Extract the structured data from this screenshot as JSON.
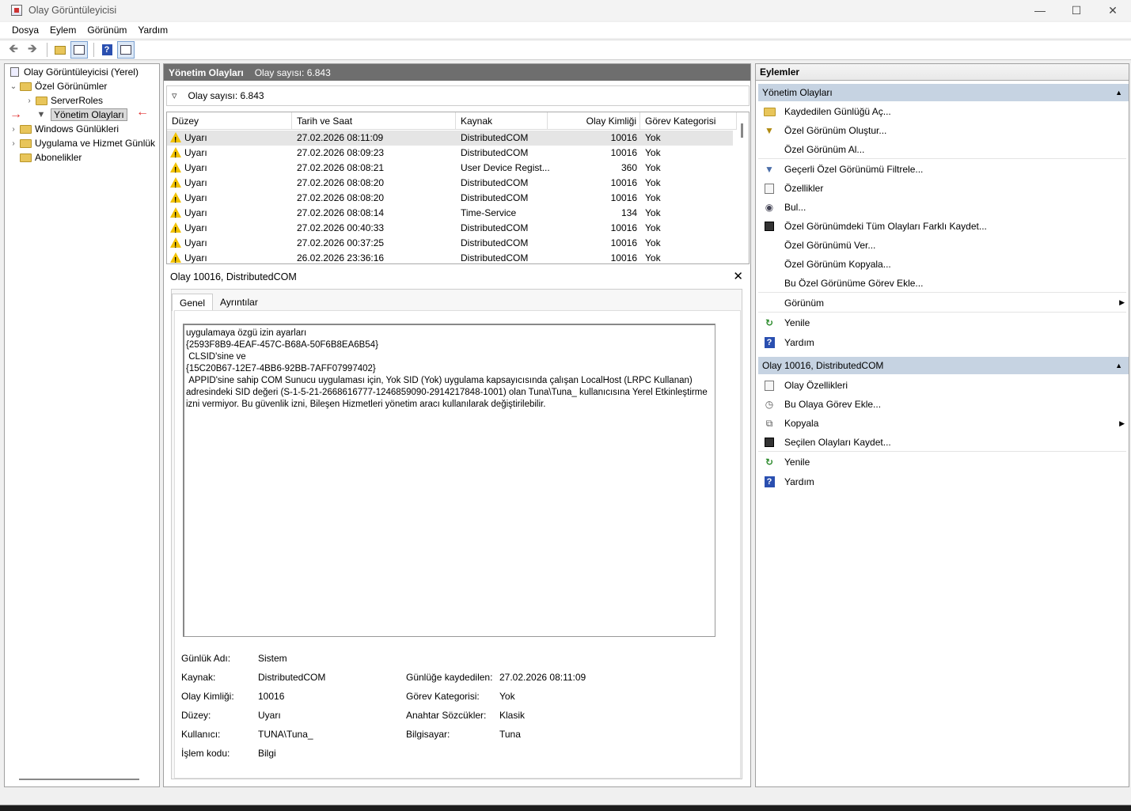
{
  "window": {
    "title": "Olay Görüntüleyicisi"
  },
  "menu": [
    "Dosya",
    "Eylem",
    "Görünüm",
    "Yardım"
  ],
  "tree": {
    "root": "Olay Görüntüleyicisi (Yerel)",
    "custom_views": "Özel Görünümler",
    "server_roles": "ServerRoles",
    "admin_events": "Yönetim Olayları",
    "windows_logs": "Windows Günlükleri",
    "app_service_logs": "Uygulama ve Hizmet Günlük",
    "subscriptions": "Abonelikler"
  },
  "middle": {
    "header_title": "Yönetim Olayları",
    "header_count": "Olay sayısı: 6.843",
    "filter_count": "Olay sayısı: 6.843",
    "columns": [
      "Düzey",
      "Tarih ve Saat",
      "Kaynak",
      "Olay Kimliği",
      "Görev Kategorisi"
    ],
    "rows": [
      {
        "level": "Uyarı",
        "date": "27.02.2026 08:11:09",
        "source": "DistributedCOM",
        "id": "10016",
        "category": "Yok"
      },
      {
        "level": "Uyarı",
        "date": "27.02.2026 08:09:23",
        "source": "DistributedCOM",
        "id": "10016",
        "category": "Yok"
      },
      {
        "level": "Uyarı",
        "date": "27.02.2026 08:08:21",
        "source": "User Device Regist...",
        "id": "360",
        "category": "Yok"
      },
      {
        "level": "Uyarı",
        "date": "27.02.2026 08:08:20",
        "source": "DistributedCOM",
        "id": "10016",
        "category": "Yok"
      },
      {
        "level": "Uyarı",
        "date": "27.02.2026 08:08:20",
        "source": "DistributedCOM",
        "id": "10016",
        "category": "Yok"
      },
      {
        "level": "Uyarı",
        "date": "27.02.2026 08:08:14",
        "source": "Time-Service",
        "id": "134",
        "category": "Yok"
      },
      {
        "level": "Uyarı",
        "date": "27.02.2026 00:40:33",
        "source": "DistributedCOM",
        "id": "10016",
        "category": "Yok"
      },
      {
        "level": "Uyarı",
        "date": "27.02.2026 00:37:25",
        "source": "DistributedCOM",
        "id": "10016",
        "category": "Yok"
      },
      {
        "level": "Uyarı",
        "date": "26.02.2026 23:36:16",
        "source": "DistributedCOM",
        "id": "10016",
        "category": "Yok"
      }
    ],
    "detail_title": "Olay 10016, DistributedCOM",
    "tabs": [
      "Genel",
      "Ayrıntılar"
    ],
    "message": "uygulamaya özgü izin ayarları\n{2593F8B9-4EAF-457C-B68A-50F6B8EA6B54}\n CLSID'sine ve\n{15C20B67-12E7-4BB6-92BB-7AFF07997402}\n APPID'sine sahip COM Sunucu uygulaması için, Yok SID (Yok) uygulama kapsayıcısında çalışan LocalHost (LRPC Kullanan)\nadresindeki SID değeri (S-1-5-21-2668616777-1246859090-2914217848-1001) olan Tuna\\Tuna_ kullanıcısına Yerel Etkinleştirme\nizni vermiyor. Bu güvenlik izni, Bileşen Hizmetleri yönetim aracı kullanılarak değiştirilebilir.",
    "props": {
      "log_name_label": "Günlük Adı:",
      "log_name": "Sistem",
      "source_label": "Kaynak:",
      "source": "DistributedCOM",
      "logged_label": "Günlüğe kaydedilen:",
      "logged": "27.02.2026 08:11:09",
      "event_id_label": "Olay Kimliği:",
      "event_id": "10016",
      "task_label": "Görev Kategorisi:",
      "task": "Yok",
      "level_label": "Düzey:",
      "level": "Uyarı",
      "keywords_label": "Anahtar Sözcükler:",
      "keywords": "Klasik",
      "user_label": "Kullanıcı:",
      "user": "TUNA\\Tuna_",
      "computer_label": "Bilgisayar:",
      "computer": "Tuna",
      "opcode_label": "İşlem kodu:",
      "opcode": "Bilgi"
    }
  },
  "actions": {
    "title": "Eylemler",
    "section1": "Yönetim Olayları",
    "items1": [
      "Kaydedilen Günlüğü Aç...",
      "Özel Görünüm Oluştur...",
      "Özel Görünüm Al...",
      "Geçerli Özel Görünümü Filtrele...",
      "Özellikler",
      "Bul...",
      "Özel Görünümdeki Tüm Olayları Farklı Kaydet...",
      "Özel Görünümü Ver...",
      "Özel Görünüm Kopyala...",
      "Bu Özel Görünüme Görev Ekle...",
      "Görünüm",
      "Yenile",
      "Yardım"
    ],
    "section2": "Olay 10016, DistributedCOM",
    "items2": [
      "Olay Özellikleri",
      "Bu Olaya Görev Ekle...",
      "Kopyala",
      "Seçilen Olayları Kaydet...",
      "Yenile",
      "Yardım"
    ]
  }
}
